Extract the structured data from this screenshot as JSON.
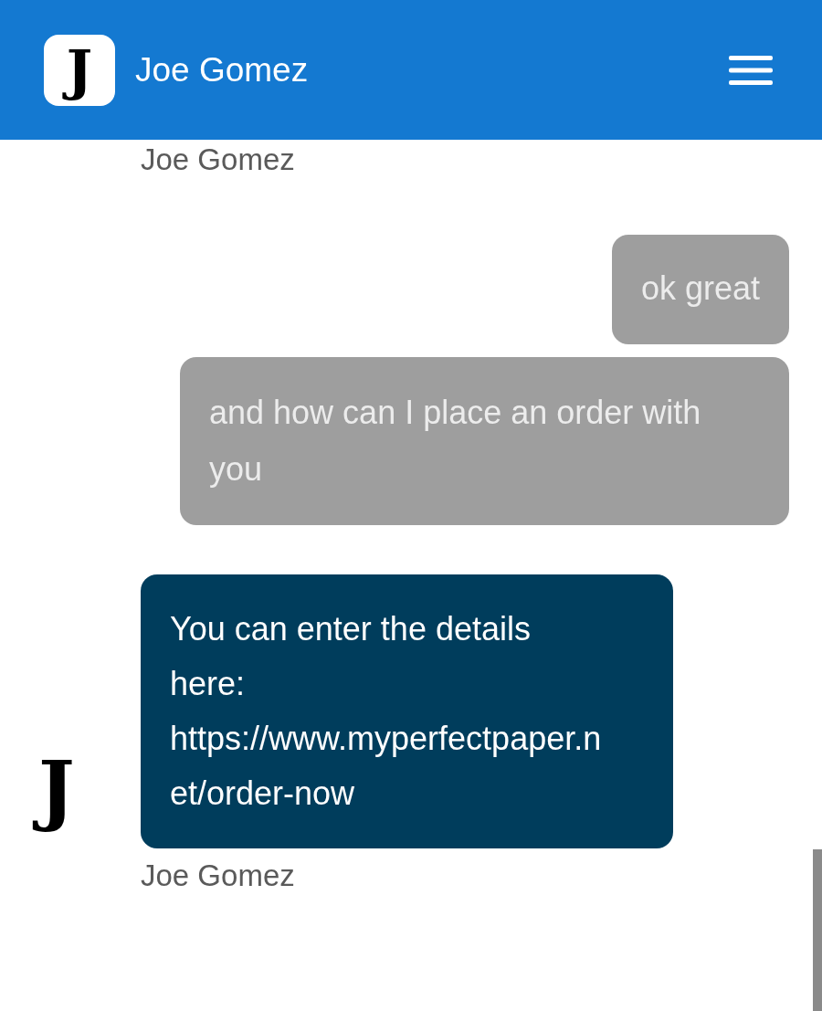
{
  "header": {
    "avatar_letter": "J",
    "title": "Joe Gomez"
  },
  "earlier_sender": "Joe Gomez",
  "messages": [
    {
      "kind": "outgoing",
      "text": "ok great"
    },
    {
      "kind": "outgoing",
      "text": "and how can I place an order with you"
    },
    {
      "kind": "incoming",
      "avatar_letter": "J",
      "text": "You can enter the details here: https://www.myperfectpaper.net/order-now",
      "sender": "Joe Gomez"
    }
  ]
}
